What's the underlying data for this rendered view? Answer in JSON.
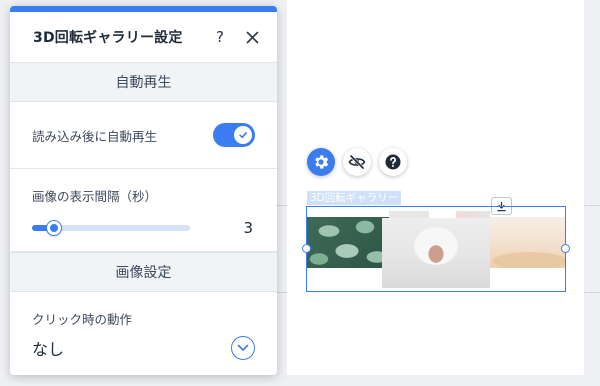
{
  "panel": {
    "title": "3D回転ギャラリー設定",
    "help_label": "?",
    "close_label": "✕"
  },
  "sections": {
    "autoplay_header": "自動再生",
    "image_settings_header": "画像設定"
  },
  "autoplay": {
    "label": "読み込み後に自動再生",
    "enabled": true
  },
  "interval": {
    "label": "画像の表示間隔（秒）",
    "value": "3",
    "slider_fraction": 0.14
  },
  "click_action": {
    "label": "クリック時の動作",
    "value": "なし"
  },
  "toolbar": {
    "settings_icon": "gear-icon",
    "hide_icon": "eye-slash-icon",
    "help_icon": "question-icon"
  },
  "component": {
    "label": "3D回転ギャラリー"
  },
  "colors": {
    "accent": "#3b7df0",
    "section_bg": "#f0f4f7"
  }
}
